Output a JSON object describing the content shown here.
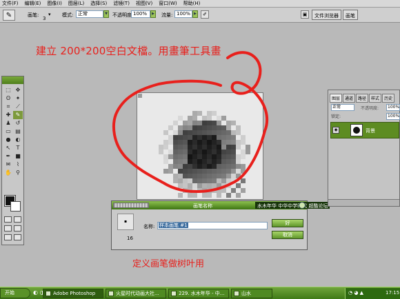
{
  "menu": [
    "文件(F)",
    "编辑(E)",
    "图像(I)",
    "图层(L)",
    "选择(S)",
    "滤镜(T)",
    "视图(V)",
    "窗口(W)",
    "帮助(H)"
  ],
  "options": {
    "brush_label": "画笔:",
    "brush_size": "3",
    "mode_label": "模式:",
    "mode_value": "正常",
    "opacity_label": "不透明度:",
    "opacity_value": "100%",
    "flow_label": "流量:",
    "flow_value": "100%",
    "well_tabs": [
      "文件浏览器",
      "画笔"
    ]
  },
  "annotations": {
    "top": "建立 200*200空白文檔。用畫筆工具畫",
    "bottom": "定义画笔做树叶用"
  },
  "dialog": {
    "title": "画笔名称",
    "tag": "水木年华 中华中学时代 超酷论坛",
    "brush_size": "16",
    "name_label": "名称:",
    "name_value": "样本画笔 #1",
    "ok_label": "好",
    "cancel_label": "取消"
  },
  "layers": {
    "tabs": [
      "图层",
      "通道",
      "路径",
      "样式",
      "历史"
    ],
    "mode": "正常",
    "opacity_label": "不透明度:",
    "opacity_value": "100%",
    "lock_label": "锁定:",
    "fill_value": "100%",
    "layer_name": "背景"
  },
  "taskbar": {
    "start_label": "开始",
    "buttons": [
      "Adobe Photoshop",
      "火星时代动画大社...",
      "229. 水木年华 - 中...",
      "山水"
    ],
    "clock": "17:15"
  },
  "colors": {
    "annotation_red": "#e8201c",
    "accent_green": "#5d8c21",
    "desktop_gray": "#b9b9b9"
  }
}
